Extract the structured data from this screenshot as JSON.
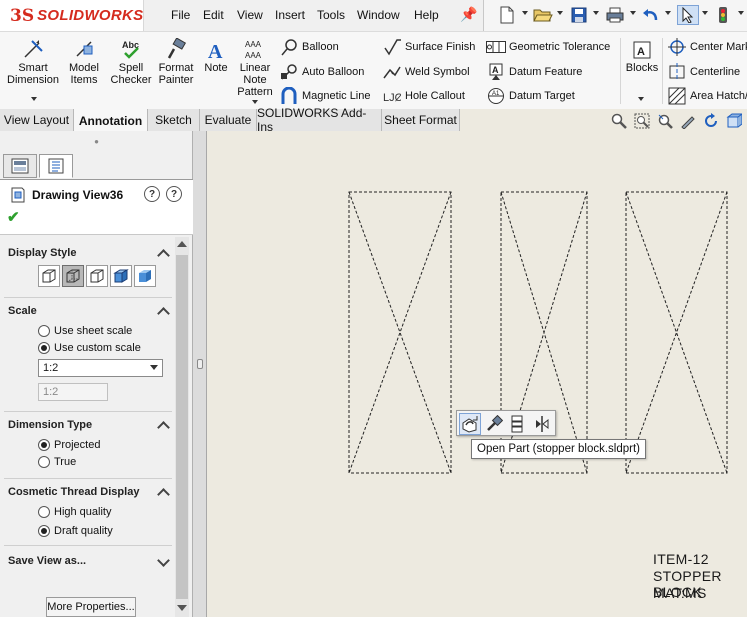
{
  "app": {
    "brand": "SOLIDWORKS",
    "brand_prefix": "3S",
    "accent": "#d52b1e"
  },
  "menu": [
    "File",
    "Edit",
    "View",
    "Insert",
    "Tools",
    "Window",
    "Help"
  ],
  "ribbon": {
    "smart_dimension": {
      "line1": "Smart",
      "line2": "Dimension"
    },
    "model_items": {
      "line1": "Model",
      "line2": "Items"
    },
    "spell_checker": {
      "line1": "Spell",
      "line2": "Checker"
    },
    "format_painter": {
      "line1": "Format",
      "line2": "Painter"
    },
    "note": "Note",
    "linear_note_pattern": {
      "line1": "Linear",
      "line2": "Note",
      "line3": "Pattern"
    },
    "balloon": "Balloon",
    "auto_balloon": "Auto Balloon",
    "magnetic_line": "Magnetic Line",
    "surface_finish": "Surface Finish",
    "weld_symbol": "Weld Symbol",
    "hole_callout": "Hole Callout",
    "geometric_tolerance": "Geometric Tolerance",
    "datum_feature": "Datum Feature",
    "datum_target": "Datum Target",
    "blocks": "Blocks",
    "center_mark": "Center Mark",
    "centerline": "Centerline",
    "area_hatch": "Area Hatch/"
  },
  "tabs": [
    "View Layout",
    "Annotation",
    "Sketch",
    "Evaluate",
    "SOLIDWORKS Add-Ins",
    "Sheet Format"
  ],
  "active_tab": "Annotation",
  "panel": {
    "title": "Drawing View36",
    "display_style": {
      "title": "Display Style",
      "selected_index": 1
    },
    "scale": {
      "title": "Scale",
      "options": [
        "Use sheet scale",
        "Use custom scale"
      ],
      "selected": "Use custom scale",
      "select_value": "1:2",
      "field_value": "1:2"
    },
    "dimension_type": {
      "title": "Dimension Type",
      "options": [
        "Projected",
        "True"
      ],
      "selected": "Projected"
    },
    "cosmetic_thread": {
      "title": "Cosmetic Thread Display",
      "options": [
        "High quality",
        "Draft quality"
      ],
      "selected": "Draft quality"
    },
    "save_view": {
      "title": "Save View as..."
    },
    "more_properties": "More Properties..."
  },
  "context_toolbar": {
    "tooltip": "Open Part (stopper block.sldprt)"
  },
  "sheet": {
    "note_lines": [
      "ITEM-12",
      "STOPPER BLOCK",
      "MAT:MS"
    ],
    "background": "#edeae0"
  }
}
